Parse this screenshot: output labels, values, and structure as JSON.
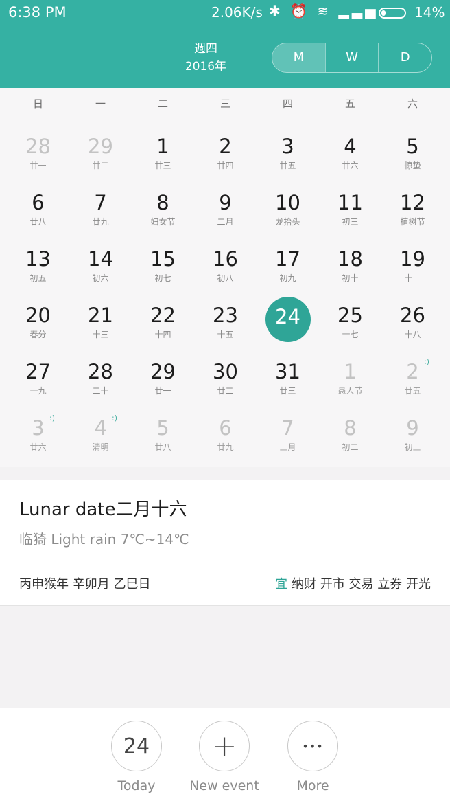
{
  "status_bar": {
    "time": "6:38 PM",
    "net_speed": "2.06K/s",
    "icons": "✱ ⏰ ≋ ▂▃▅",
    "battery": "14%"
  },
  "header": {
    "weekday": "週四",
    "year": "2016年",
    "views": [
      "M",
      "W",
      "D"
    ],
    "active_view": "M",
    "accent_color": "#35b1a3"
  },
  "calendar": {
    "weekdays": [
      "日",
      "一",
      "二",
      "三",
      "四",
      "五",
      "六"
    ],
    "weeks": [
      [
        {
          "d": "28",
          "l": "廿一",
          "other": true
        },
        {
          "d": "29",
          "l": "廿二",
          "other": true
        },
        {
          "d": "1",
          "l": "廿三"
        },
        {
          "d": "2",
          "l": "廿四"
        },
        {
          "d": "3",
          "l": "廿五"
        },
        {
          "d": "4",
          "l": "廿六"
        },
        {
          "d": "5",
          "l": "惊蛰"
        }
      ],
      [
        {
          "d": "6",
          "l": "廿八"
        },
        {
          "d": "7",
          "l": "廿九"
        },
        {
          "d": "8",
          "l": "妇女节"
        },
        {
          "d": "9",
          "l": "二月"
        },
        {
          "d": "10",
          "l": "龙抬头"
        },
        {
          "d": "11",
          "l": "初三"
        },
        {
          "d": "12",
          "l": "植树节"
        }
      ],
      [
        {
          "d": "13",
          "l": "初五"
        },
        {
          "d": "14",
          "l": "初六"
        },
        {
          "d": "15",
          "l": "初七"
        },
        {
          "d": "16",
          "l": "初八"
        },
        {
          "d": "17",
          "l": "初九"
        },
        {
          "d": "18",
          "l": "初十"
        },
        {
          "d": "19",
          "l": "十一"
        }
      ],
      [
        {
          "d": "20",
          "l": "春分"
        },
        {
          "d": "21",
          "l": "十三"
        },
        {
          "d": "22",
          "l": "十四"
        },
        {
          "d": "23",
          "l": "十五"
        },
        {
          "d": "24",
          "l": "",
          "today": true
        },
        {
          "d": "25",
          "l": "十七"
        },
        {
          "d": "26",
          "l": "十八"
        }
      ],
      [
        {
          "d": "27",
          "l": "十九"
        },
        {
          "d": "28",
          "l": "二十"
        },
        {
          "d": "29",
          "l": "廿一"
        },
        {
          "d": "30",
          "l": "廿二"
        },
        {
          "d": "31",
          "l": "廿三"
        },
        {
          "d": "1",
          "l": "愚人节",
          "other": true
        },
        {
          "d": "2",
          "l": "廿五",
          "other": true,
          "wx": ":)"
        }
      ],
      [
        {
          "d": "3",
          "l": "廿六",
          "other": true,
          "wx": ":)"
        },
        {
          "d": "4",
          "l": "清明",
          "other": true,
          "wx": ":)"
        },
        {
          "d": "5",
          "l": "廿八",
          "other": true
        },
        {
          "d": "6",
          "l": "廿九",
          "other": true
        },
        {
          "d": "7",
          "l": "三月",
          "other": true
        },
        {
          "d": "8",
          "l": "初二",
          "other": true
        },
        {
          "d": "9",
          "l": "初三",
          "other": true
        }
      ]
    ]
  },
  "info": {
    "lunar_title": "Lunar date二月十六",
    "weather": "临猗  Light rain  7℃~14℃",
    "ganzhi": "丙申猴年 辛卯月 乙巳日",
    "yi_label": "宜",
    "yi_items": "纳财 开市 交易 立券 开光"
  },
  "actions": {
    "today_number": "24",
    "today_label": "Today",
    "new_event_icon": "+",
    "new_event_label": "New event",
    "more_icon": "•••",
    "more_label": "More"
  }
}
